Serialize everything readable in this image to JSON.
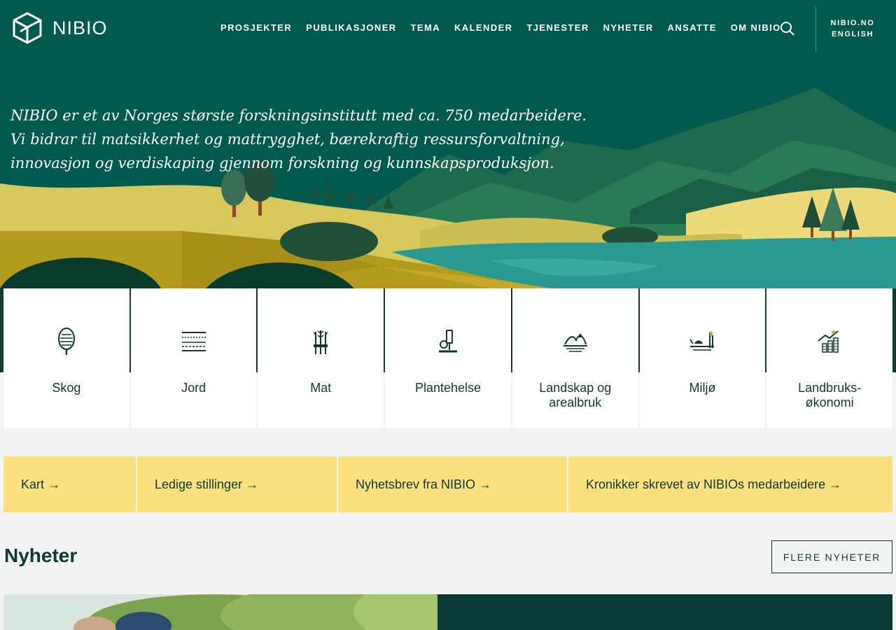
{
  "header": {
    "logo_text": "NIBIO",
    "nav": [
      "PROSJEKTER",
      "PUBLIKASJONER",
      "TEMA",
      "KALENDER",
      "TJENESTER",
      "NYHETER",
      "ANSATTE",
      "OM NIBIO"
    ],
    "lang": [
      "NIBIO.NO",
      "ENGLISH"
    ]
  },
  "intro": {
    "lines": [
      "NIBIO er et av Norges største forskningsinstitutt med ca. 750 medarbeidere.",
      "Vi bidrar til matsikkerhet og mattrygghet, bærekraftig ressursforvaltning,",
      "innovasjon og verdiskaping gjennom forskning og kunnskapsproduksjon."
    ]
  },
  "topics": [
    {
      "label": "Skog",
      "icon": "tree-icon"
    },
    {
      "label": "Jord",
      "icon": "soil-layers-icon"
    },
    {
      "label": "Mat",
      "icon": "wheat-icon"
    },
    {
      "label": "Plantehelse",
      "icon": "microscope-icon"
    },
    {
      "label": "Landskap og\narealbruk",
      "icon": "landscape-icon"
    },
    {
      "label": "Miljø",
      "icon": "wetland-icon"
    },
    {
      "label": "Landbruks-\nøkonomi",
      "icon": "economy-chart-icon"
    }
  ],
  "quick_links": [
    "Kart →",
    "Ledige stillinger →",
    "Nyhetsbrev fra NIBIO →",
    "Kronikker skrevet av NIBIOs medarbeidere →"
  ],
  "news": {
    "title": "Nyheter",
    "more_label": "FLERE NYHETER"
  },
  "colors": {
    "header_bg": "#02594d",
    "accent_yellow": "#fbe07f",
    "text_dark": "#0f3a33",
    "page_bg": "#f2f4f3"
  }
}
